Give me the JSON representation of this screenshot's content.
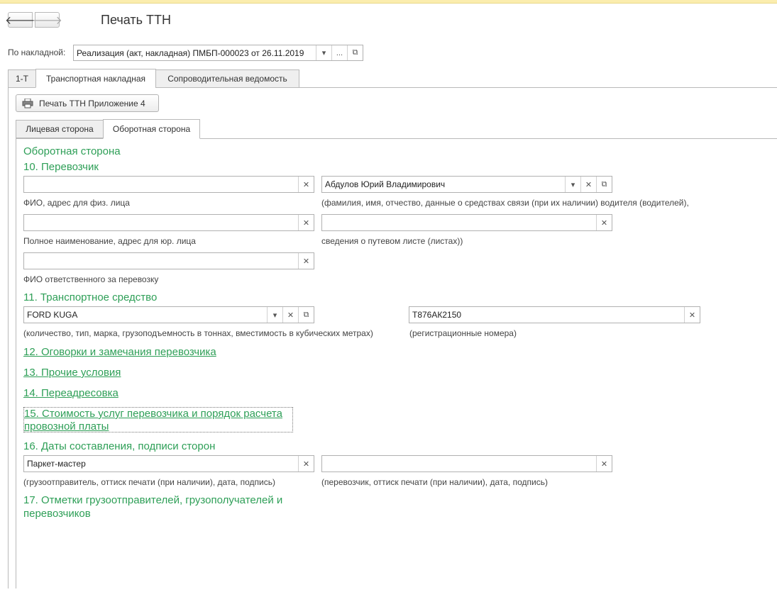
{
  "window": {
    "title": "Печать ТТН"
  },
  "nav": {
    "back": "🡐",
    "forward": "🡒"
  },
  "invoice": {
    "label": "По накладной:",
    "value": "Реализация (акт, накладная) ПМБП-000023 от 26.11.2019",
    "dots": "..."
  },
  "tabs": [
    "1-Т",
    "Транспортная накладная",
    "Сопроводительная ведомость"
  ],
  "print_button": "Печать ТТН Приложение 4",
  "subtabs": [
    "Лицевая сторона",
    "Оборотная сторона"
  ],
  "section_main": "Оборотная сторона",
  "s10": {
    "title": "10. Перевозчик",
    "fio_value": "",
    "fio_caption": "ФИО, адрес для физ. лица",
    "driver_value": "Абдулов Юрий Владимирович",
    "driver_caption": "(фамилия, имя, отчество, данные о средствах связи (при их наличии)  водителя (водителей),",
    "org_value": "",
    "org_caption": "Полное наименование, адрес для юр. лица",
    "waybill_value": "",
    "waybill_caption": "сведения о путевом листе (листах))",
    "resp_value": "",
    "resp_caption": "ФИО ответственного за перевозку"
  },
  "s11": {
    "title": "11. Транспортное средство",
    "vehicle_value": "FORD KUGA",
    "vehicle_caption": "(количество, тип, марка, грузоподъемность в тоннах, вместимость в кубических метрах)",
    "reg_value": "Т876АК2150",
    "reg_caption": "(регистрационные номера)"
  },
  "links": {
    "s12": "12. Оговорки и замечания перевозчика",
    "s13": "13. Прочие условия",
    "s14": "14. Переадресовка",
    "s15_line1": "15. Стоимость услуг перевозчика и порядок расчета",
    "s15_line2": "провозной платы"
  },
  "s16": {
    "title": "16. Даты составления, подписи сторон",
    "shipper_value": "Паркет-мастер",
    "shipper_caption": "(грузоотправитель, оттиск печати (при наличии), дата, подпись)",
    "carrier_value": "",
    "carrier_caption": "(перевозчик, оттиск печати (при наличии), дата, подпись)"
  },
  "s17": {
    "title_line1": "17. Отметки грузоотправителей, грузополучателей и",
    "title_line2": "перевозчиков"
  },
  "colors": {
    "accent_green": "#2e9f57",
    "top_strip": "#fbedae"
  }
}
